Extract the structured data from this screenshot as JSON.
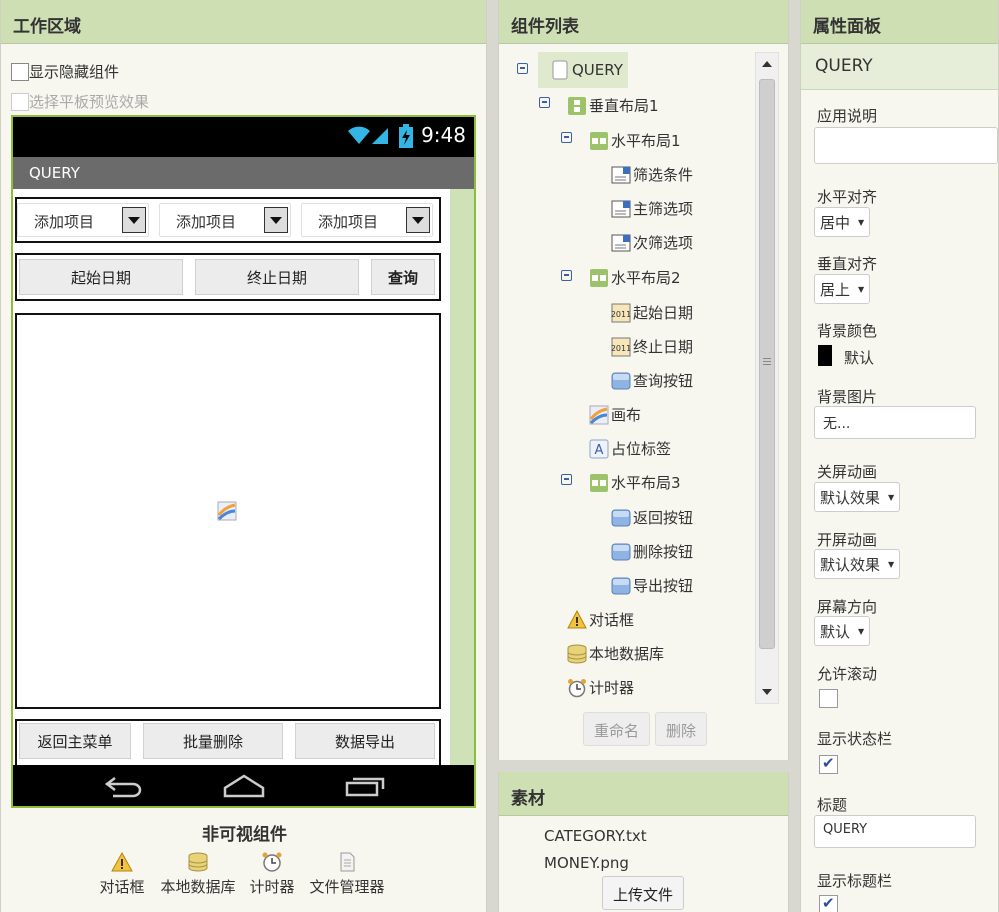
{
  "viewer": {
    "header": "工作区域",
    "show_hidden_label": "显示隐藏组件",
    "tablet_preview_label": "选择平板预览效果",
    "clock": "9:48",
    "screen_title": "QUERY",
    "spinners": [
      "添加项目",
      "添加项目",
      "添加项目"
    ],
    "row2_buttons": [
      "起始日期",
      "终止日期",
      "查询"
    ],
    "row3_buttons": [
      "返回主菜单",
      "批量删除",
      "数据导出"
    ],
    "nonvisible_title": "非可视组件",
    "nonvisible": [
      "对话框",
      "本地数据库",
      "计时器",
      "文件管理器"
    ]
  },
  "components": {
    "header": "组件列表",
    "tree": [
      {
        "label": "QUERY",
        "icon": "screen-icon"
      },
      {
        "label": "垂直布局1",
        "icon": "vertical-arrangement-icon"
      },
      {
        "label": "水平布局1",
        "icon": "horizontal-arrangement-icon"
      },
      {
        "label": "筛选条件",
        "icon": "spinner-icon"
      },
      {
        "label": "主筛选项",
        "icon": "spinner-icon"
      },
      {
        "label": "次筛选项",
        "icon": "spinner-icon"
      },
      {
        "label": "水平布局2",
        "icon": "horizontal-arrangement-icon"
      },
      {
        "label": "起始日期",
        "icon": "datepicker-icon"
      },
      {
        "label": "终止日期",
        "icon": "datepicker-icon"
      },
      {
        "label": "查询按钮",
        "icon": "button-icon"
      },
      {
        "label": "画布",
        "icon": "canvas-icon"
      },
      {
        "label": "占位标签",
        "icon": "label-icon"
      },
      {
        "label": "水平布局3",
        "icon": "horizontal-arrangement-icon"
      },
      {
        "label": "返回按钮",
        "icon": "button-icon"
      },
      {
        "label": "删除按钮",
        "icon": "button-icon"
      },
      {
        "label": "导出按钮",
        "icon": "button-icon"
      },
      {
        "label": "对话框",
        "icon": "notifier-icon"
      },
      {
        "label": "本地数据库",
        "icon": "tinydb-icon"
      },
      {
        "label": "计时器",
        "icon": "clock-icon"
      }
    ],
    "rename_label": "重命名",
    "delete_label": "删除"
  },
  "assets": {
    "header": "素材",
    "files": [
      "CATEGORY.txt",
      "MONEY.png"
    ],
    "upload_label": "上传文件"
  },
  "properties": {
    "header": "属性面板",
    "component_name": "QUERY",
    "app_description_label": "应用说明",
    "app_description_value": "",
    "align_horizontal_label": "水平对齐",
    "align_horizontal_value": "居中",
    "align_vertical_label": "垂直对齐",
    "align_vertical_value": "居上",
    "bg_color_label": "背景颜色",
    "bg_color_value": "默认",
    "bg_image_label": "背景图片",
    "bg_image_value": "无...",
    "close_anim_label": "关屏动画",
    "close_anim_value": "默认效果",
    "open_anim_label": "开屏动画",
    "open_anim_value": "默认效果",
    "orientation_label": "屏幕方向",
    "orientation_value": "默认",
    "scrollable_label": "允许滚动",
    "show_statusbar_label": "显示状态栏",
    "title_label": "标题",
    "title_value": "QUERY",
    "show_titlebar_label": "显示标题栏"
  },
  "colors": {
    "header_bg": "#cfdfb4",
    "accent_green": "#8fbc3a",
    "checkbox_blue": "#2c4d9b"
  }
}
